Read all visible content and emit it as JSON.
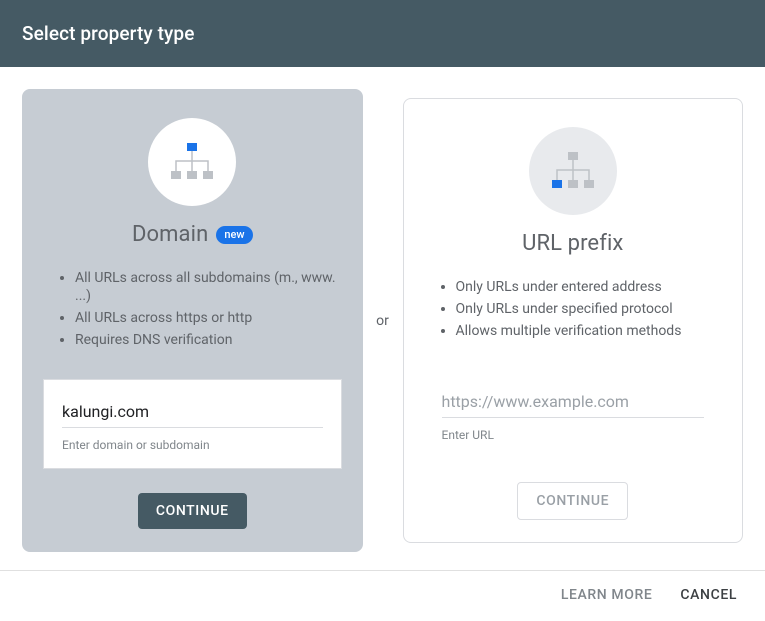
{
  "header": {
    "title": "Select property type"
  },
  "separator": "or",
  "domain_card": {
    "title": "Domain",
    "badge": "new",
    "bullets": [
      "All URLs across all subdomains (m., www. ...)",
      "All URLs across https or http",
      "Requires DNS verification"
    ],
    "input_value": "kalungi.com",
    "input_placeholder": "",
    "helper": "Enter domain or subdomain",
    "continue_label": "CONTINUE"
  },
  "url_prefix_card": {
    "title": "URL prefix",
    "bullets": [
      "Only URLs under entered address",
      "Only URLs under specified protocol",
      "Allows multiple verification methods"
    ],
    "input_value": "",
    "input_placeholder": "https://www.example.com",
    "helper": "Enter URL",
    "continue_label": "CONTINUE"
  },
  "footer": {
    "learn_more": "LEARN MORE",
    "cancel": "CANCEL"
  }
}
